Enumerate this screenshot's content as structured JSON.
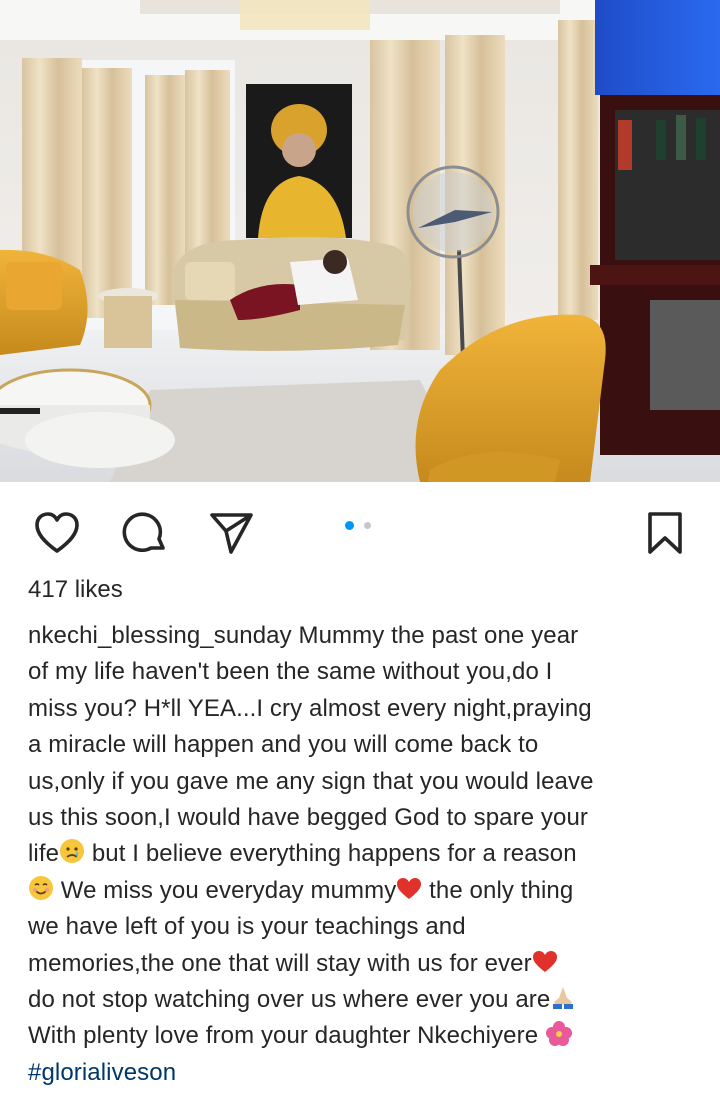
{
  "post": {
    "likes": "417 likes",
    "username": "nkechi_blessing_sunday",
    "caption_lines": [
      " Mummy the past one year",
      "of my life haven't been the same without you,do I",
      "miss you? H*ll YEA...I cry almost every night,praying",
      "a miracle will happen and you will come back to",
      "us,only if you gave me any sign that you would leave",
      "us this soon,I would have begged God to spare your",
      "life",
      " but I believe everything happens for a reason",
      " We miss you everyday mummy",
      " the only thing",
      "we have left of you is your teachings and",
      "memories,the one that will stay with us for ever",
      "do not stop watching over us where ever you are",
      "With plenty love from your daughter Nkechiyere "
    ],
    "hashtag": "#glorialiveson",
    "carousel": {
      "total": 2,
      "active": 1
    }
  },
  "icons": {
    "like": "heart-icon",
    "comment": "comment-icon",
    "share": "send-icon",
    "save": "bookmark-icon"
  },
  "colors": {
    "text": "#262626",
    "hashtag": "#00376b",
    "dot_active": "#0095f6",
    "dot_inactive": "#c7c7c7"
  }
}
